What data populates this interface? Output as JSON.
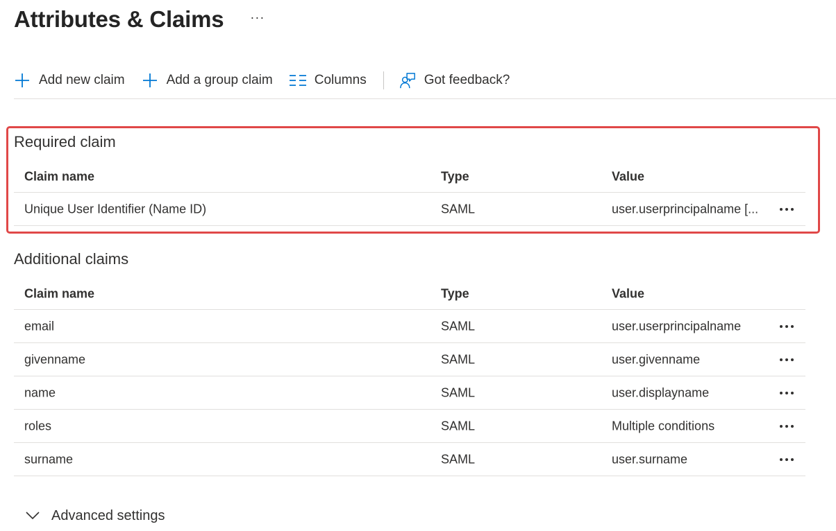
{
  "page": {
    "title": "Attributes & Claims",
    "more_label": "···"
  },
  "toolbar": {
    "add_claim": "Add new claim",
    "add_group_claim": "Add a group claim",
    "columns": "Columns",
    "feedback": "Got feedback?"
  },
  "required": {
    "title": "Required claim",
    "headers": {
      "name": "Claim name",
      "type": "Type",
      "value": "Value"
    },
    "rows": [
      {
        "name": "Unique User Identifier (Name ID)",
        "type": "SAML",
        "value": "user.userprincipalname [..."
      }
    ]
  },
  "additional": {
    "title": "Additional claims",
    "headers": {
      "name": "Claim name",
      "type": "Type",
      "value": "Value"
    },
    "rows": [
      {
        "name": "email",
        "type": "SAML",
        "value": "user.userprincipalname"
      },
      {
        "name": "givenname",
        "type": "SAML",
        "value": "user.givenname"
      },
      {
        "name": "name",
        "type": "SAML",
        "value": "user.displayname"
      },
      {
        "name": "roles",
        "type": "SAML",
        "value": "Multiple conditions"
      },
      {
        "name": "surname",
        "type": "SAML",
        "value": "user.surname"
      }
    ]
  },
  "advanced": {
    "label": "Advanced settings"
  },
  "colors": {
    "accent": "#0078d4",
    "highlight": "#e04848",
    "divider": "#e1dfdd"
  },
  "icons": {
    "add_claim": "add-icon",
    "add_group_claim": "add-icon",
    "columns": "columns-icon",
    "feedback": "feedback-icon",
    "row_more": "more-icon",
    "advanced": "chevron-down-icon"
  }
}
